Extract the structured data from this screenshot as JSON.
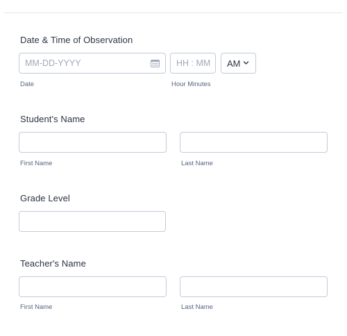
{
  "observation": {
    "label": "Date & Time of Observation",
    "date_placeholder": "MM-DD-YYYY",
    "date_sublabel": "Date",
    "time_placeholder": "HH : MM",
    "time_sublabel": "Hour Minutes",
    "ampm_value": "AM"
  },
  "student": {
    "label": "Student's Name",
    "first_sublabel": "First Name",
    "last_sublabel": "Last Name"
  },
  "grade": {
    "label": "Grade Level"
  },
  "teacher": {
    "label": "Teacher's Name",
    "first_sublabel": "First Name",
    "last_sublabel": "Last Name"
  }
}
